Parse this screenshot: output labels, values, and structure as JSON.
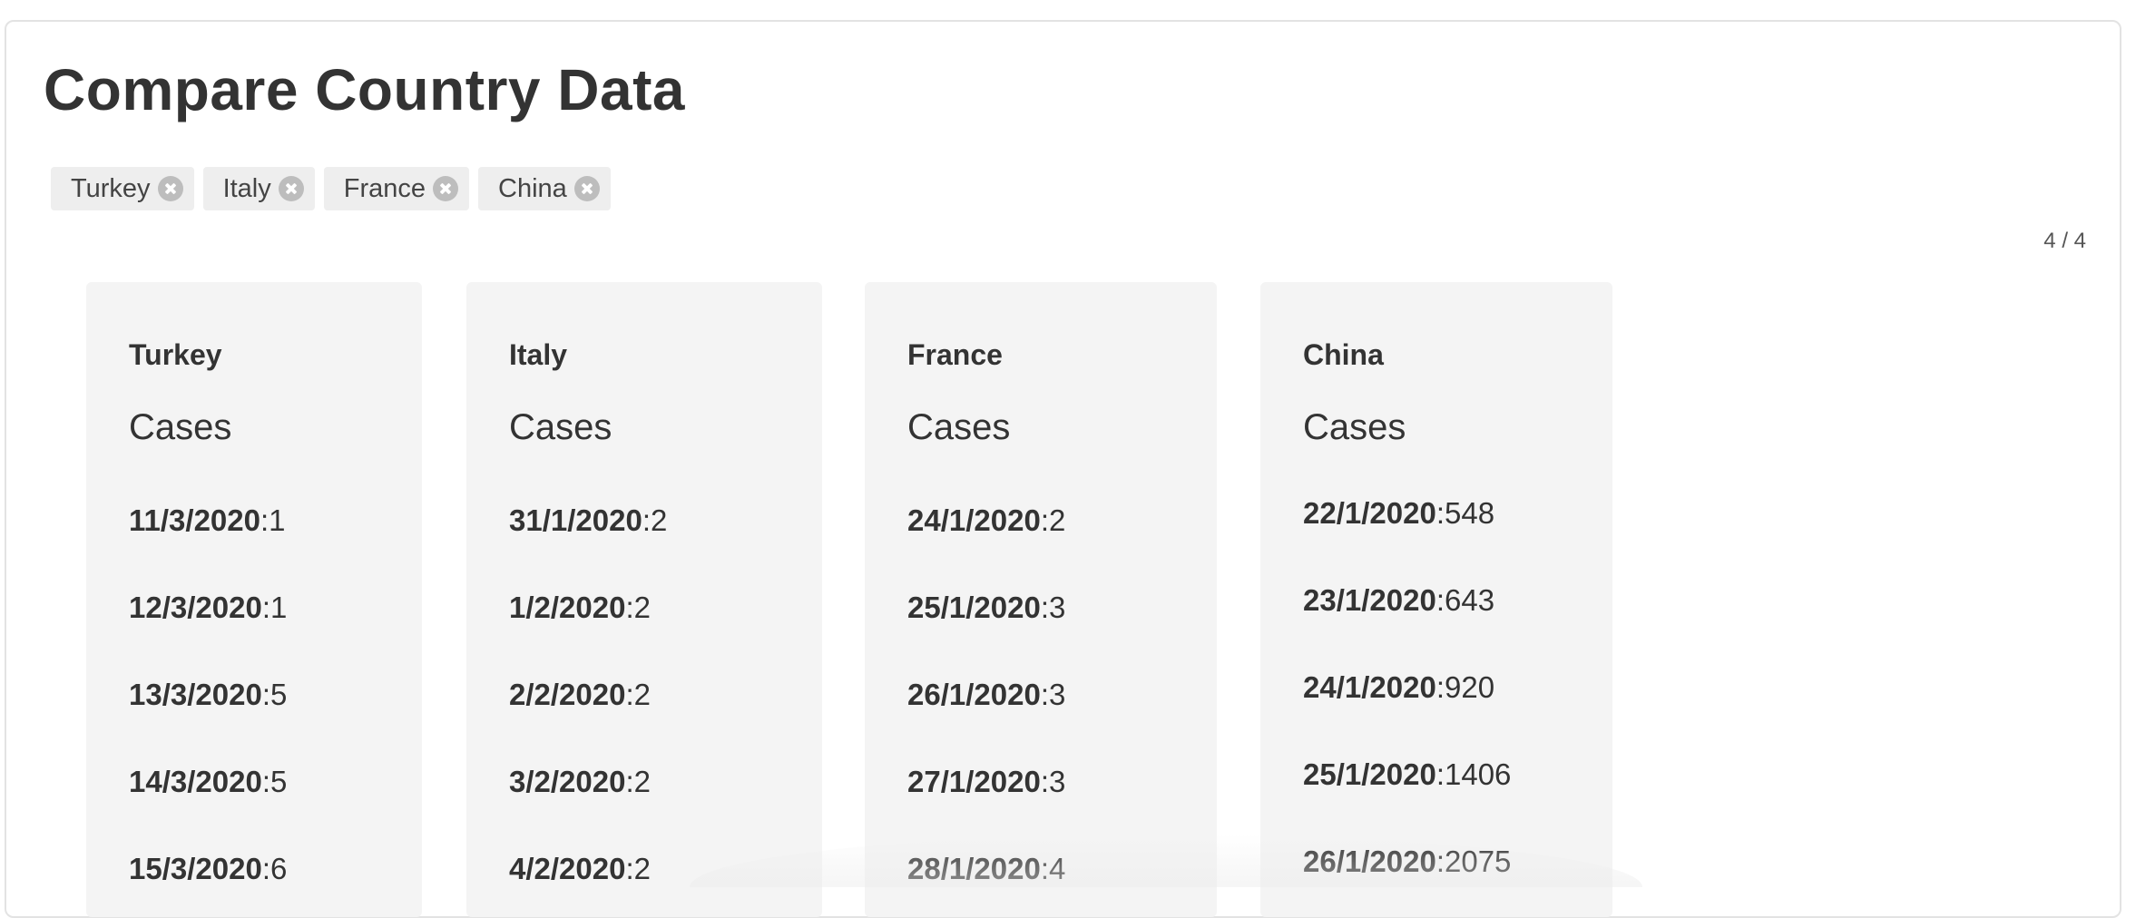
{
  "page": {
    "title": "Compare Country Data",
    "counter": "4 / 4"
  },
  "chips": [
    {
      "label": "Turkey"
    },
    {
      "label": "Italy"
    },
    {
      "label": "France"
    },
    {
      "label": "China"
    }
  ],
  "cards": [
    {
      "country": "Turkey",
      "subtitle": "Cases",
      "entries": [
        {
          "date": "11/3/2020",
          "value": "1"
        },
        {
          "date": "12/3/2020",
          "value": "1"
        },
        {
          "date": "13/3/2020",
          "value": "5"
        },
        {
          "date": "14/3/2020",
          "value": "5"
        },
        {
          "date": "15/3/2020",
          "value": "6"
        }
      ]
    },
    {
      "country": "Italy",
      "subtitle": "Cases",
      "entries": [
        {
          "date": "31/1/2020",
          "value": "2"
        },
        {
          "date": "1/2/2020",
          "value": "2"
        },
        {
          "date": "2/2/2020",
          "value": "2"
        },
        {
          "date": "3/2/2020",
          "value": "2"
        },
        {
          "date": "4/2/2020",
          "value": "2"
        }
      ]
    },
    {
      "country": "France",
      "subtitle": "Cases",
      "entries": [
        {
          "date": "24/1/2020",
          "value": "2"
        },
        {
          "date": "25/1/2020",
          "value": "3"
        },
        {
          "date": "26/1/2020",
          "value": "3"
        },
        {
          "date": "27/1/2020",
          "value": "3"
        },
        {
          "date": "28/1/2020",
          "value": "4"
        }
      ]
    },
    {
      "country": "China",
      "subtitle": "Cases",
      "entries": [
        {
          "date": "22/1/2020",
          "value": "548"
        },
        {
          "date": "23/1/2020",
          "value": "643"
        },
        {
          "date": "24/1/2020",
          "value": "920"
        },
        {
          "date": "25/1/2020",
          "value": "1406"
        },
        {
          "date": "26/1/2020",
          "value": "2075"
        }
      ]
    }
  ]
}
